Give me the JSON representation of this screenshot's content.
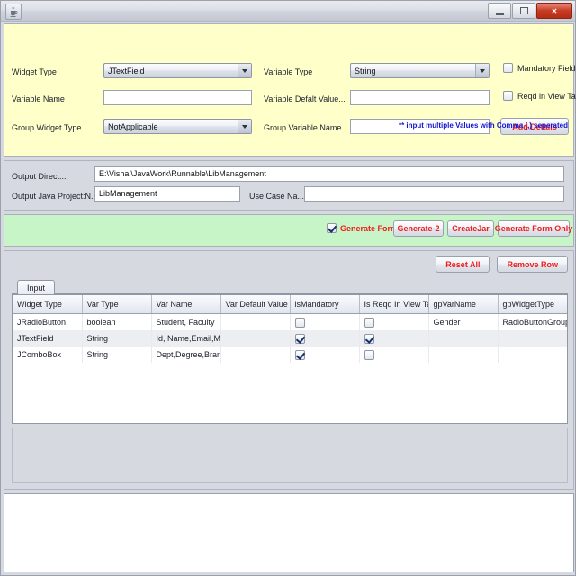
{
  "window": {
    "icon": "java-coffee-cup-icon",
    "title": "",
    "minimize_label": "minimize-icon",
    "maximize_label": "maximize-icon",
    "close_label": "✕"
  },
  "form": {
    "widget_type_label": "Widget Type",
    "widget_type_value": "JTextField",
    "variable_name_label": "Variable Name",
    "variable_name_value": "",
    "group_widget_type_label": "Group Widget Type",
    "group_widget_type_value": "NotApplicable",
    "variable_type_label": "Variable Type",
    "variable_type_value": "String",
    "variable_default_label": "Variable Defalt Value...",
    "variable_default_value": "",
    "group_variable_name_label": "Group Variable Name",
    "group_variable_name_value": "",
    "mandatory_field_label": "Mandatory Field",
    "mandatory_field_checked": false,
    "reqd_view_table_label": "Reqd in View Table",
    "reqd_view_table_checked": false,
    "add_details_label": "Add Details",
    "hint": "** input multiple Values with Comma (,) seperated"
  },
  "output": {
    "directory_label": "Output Direct...",
    "directory_value": "E:\\Vishal\\JavaWork\\Runnable\\LibManagement",
    "project_label": "Output Java Project:N...",
    "project_value": "LibManagement",
    "usecase_label": "Use Case Na...",
    "usecase_value": ""
  },
  "generate": {
    "generate_form_label": "Generate Form",
    "generate_form_checked": true,
    "generate_2_label": "Generate-2",
    "create_jar_label": "CreateJar",
    "generate_form_only_label": "Generate Form Only"
  },
  "table_toolbar": {
    "reset_all_label": "Reset All",
    "remove_row_label": "Remove Row"
  },
  "tabs": [
    {
      "label": "Input",
      "active": true
    }
  ],
  "grid": {
    "columns": [
      "Widget Type",
      "Var Type",
      "Var Name",
      "Var Default Value",
      "isMandatory",
      "Is Reqd In View Table",
      "gpVarName",
      "gpWidgetType"
    ],
    "rows": [
      {
        "widget_type": "JRadioButton",
        "var_type": "boolean",
        "var_name": "Student, Faculty",
        "var_default_value": "",
        "is_mandatory": false,
        "is_reqd_in_view_table": false,
        "gp_var_name": "Gender",
        "gp_widget_type": "RadioButtonGroup"
      },
      {
        "widget_type": "JTextField",
        "var_type": "String",
        "var_name": "Id, Name,Email,Mob...",
        "var_default_value": "",
        "is_mandatory": true,
        "is_reqd_in_view_table": true,
        "gp_var_name": "",
        "gp_widget_type": ""
      },
      {
        "widget_type": "JComboBox",
        "var_type": "String",
        "var_name": "Dept,Degree,Branc...",
        "var_default_value": "",
        "is_mandatory": true,
        "is_reqd_in_view_table": false,
        "gp_var_name": "",
        "gp_widget_type": ""
      }
    ]
  },
  "log": {
    "text": ""
  },
  "colors": {
    "form_background": "#feffc9",
    "generate_bar_background": "#c8f5c8",
    "button_text": "#f01c1c",
    "hint_text": "#1414d2",
    "panel_background": "#d6d9e0"
  }
}
